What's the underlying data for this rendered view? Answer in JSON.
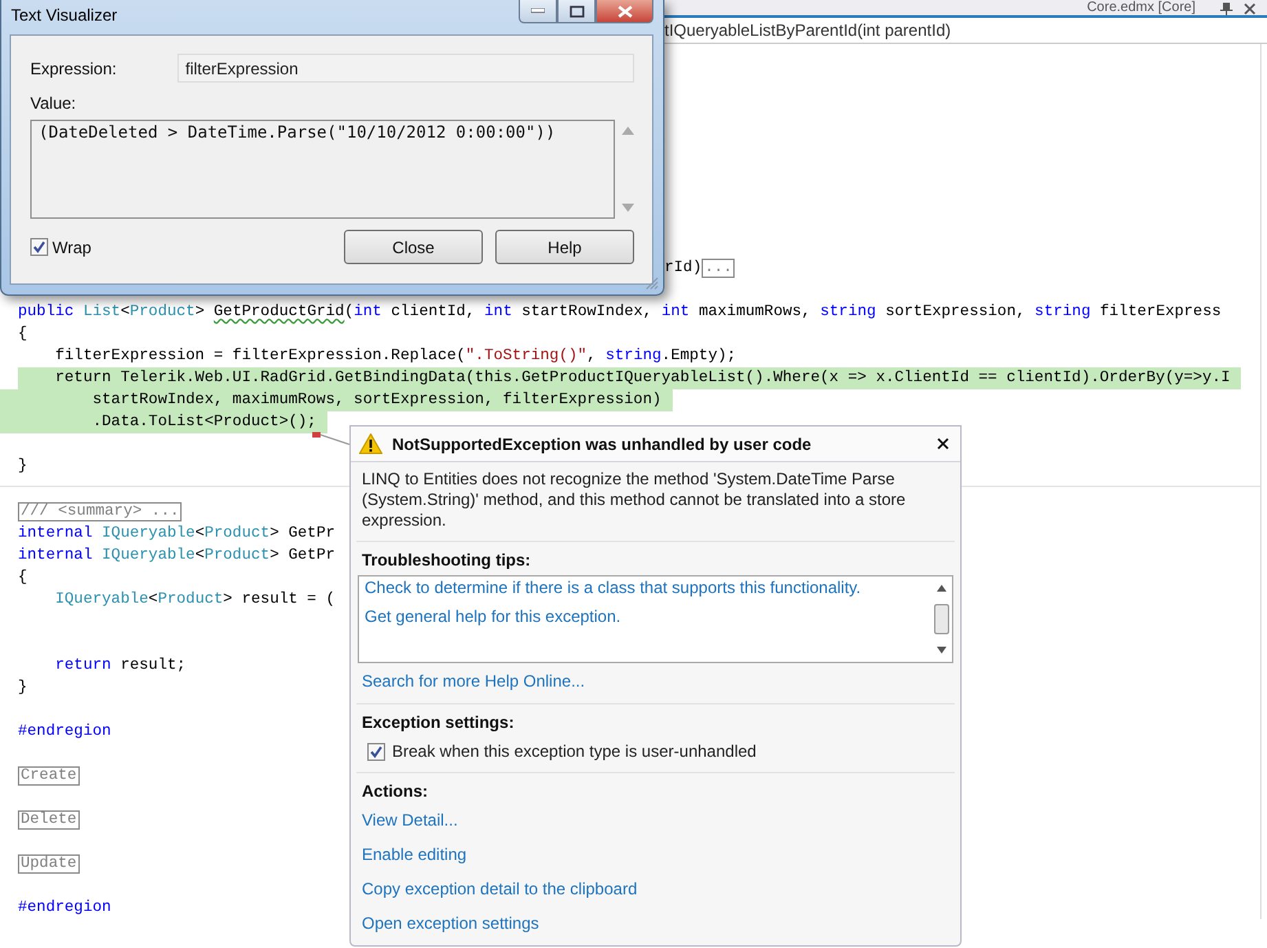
{
  "ide": {
    "document_tab": "Core.edmx [Core]",
    "member_dropdown": "tIQueryableListByParentId(int parentId)"
  },
  "code_lines": [
    {
      "kind": "tail",
      "highlighted": false,
      "tokens": [
        {
          "kind": "plain",
          "text": "rId)"
        },
        {
          "kind": "collapsed",
          "text": "..."
        }
      ]
    },
    {
      "kind": "blank"
    },
    {
      "kind": "code",
      "highlighted": false,
      "tokens": [
        {
          "kind": "kw",
          "text": "public "
        },
        {
          "kind": "type",
          "text": "List"
        },
        {
          "kind": "plain",
          "text": "<"
        },
        {
          "kind": "type",
          "text": "Product"
        },
        {
          "kind": "plain",
          "text": "> "
        },
        {
          "kind": "squiggled",
          "text": "GetProductGrid"
        },
        {
          "kind": "plain",
          "text": "("
        },
        {
          "kind": "kw",
          "text": "int"
        },
        {
          "kind": "plain",
          "text": " clientId, "
        },
        {
          "kind": "kw",
          "text": "int"
        },
        {
          "kind": "plain",
          "text": " startRowIndex, "
        },
        {
          "kind": "kw",
          "text": "int"
        },
        {
          "kind": "plain",
          "text": " maximumRows, "
        },
        {
          "kind": "kw",
          "text": "string"
        },
        {
          "kind": "plain",
          "text": " sortExpression, "
        },
        {
          "kind": "kw",
          "text": "string"
        },
        {
          "kind": "plain",
          "text": " filterExpress"
        }
      ]
    },
    {
      "kind": "code",
      "highlighted": false,
      "tokens": [
        {
          "kind": "plain",
          "text": "{"
        }
      ]
    },
    {
      "kind": "code",
      "highlighted": false,
      "tokens": [
        {
          "kind": "plain",
          "text": "    filterExpression = filterExpression.Replace("
        },
        {
          "kind": "string",
          "text": "\".ToString()\""
        },
        {
          "kind": "plain",
          "text": ", "
        },
        {
          "kind": "kw",
          "text": "string"
        },
        {
          "kind": "plain",
          "text": ".Empty);"
        }
      ]
    },
    {
      "kind": "code",
      "highlighted": true,
      "tokens": [
        {
          "kind": "plain",
          "text": "    return Telerik.Web.UI.RadGrid.GetBindingData(this.GetProductIQueryableList().Where(x => x.ClientId == clientId).OrderBy(y=>y.I"
        }
      ]
    },
    {
      "kind": "code",
      "highlighted": true,
      "tokens": [
        {
          "kind": "plain",
          "text": "        startRowIndex, maximumRows, sortExpression, filterExpression)"
        }
      ]
    },
    {
      "kind": "code",
      "highlighted": true,
      "tokens": [
        {
          "kind": "plain",
          "text": "        .Data.ToList<Product>();"
        }
      ]
    },
    {
      "kind": "blank"
    },
    {
      "kind": "code",
      "highlighted": false,
      "tokens": [
        {
          "kind": "plain",
          "text": "}"
        }
      ]
    },
    {
      "kind": "break"
    },
    {
      "kind": "code",
      "highlighted": false,
      "tokens": [
        {
          "kind": "collapsed",
          "text": "/// <summary> ..."
        }
      ]
    },
    {
      "kind": "code",
      "highlighted": false,
      "tokens": [
        {
          "kind": "kw",
          "text": "internal "
        },
        {
          "kind": "type",
          "text": "IQueryable"
        },
        {
          "kind": "plain",
          "text": "<"
        },
        {
          "kind": "type",
          "text": "Product"
        },
        {
          "kind": "plain",
          "text": "> GetPr"
        }
      ]
    },
    {
      "kind": "code",
      "highlighted": false,
      "tokens": [
        {
          "kind": "kw",
          "text": "internal "
        },
        {
          "kind": "type",
          "text": "IQueryable"
        },
        {
          "kind": "plain",
          "text": "<"
        },
        {
          "kind": "type",
          "text": "Product"
        },
        {
          "kind": "plain",
          "text": "> GetPr"
        }
      ]
    },
    {
      "kind": "code",
      "highlighted": false,
      "tokens": [
        {
          "kind": "plain",
          "text": "{"
        }
      ]
    },
    {
      "kind": "code",
      "highlighted": false,
      "tokens": [
        {
          "kind": "type",
          "text": "    IQueryable"
        },
        {
          "kind": "plain",
          "text": "<"
        },
        {
          "kind": "type",
          "text": "Product"
        },
        {
          "kind": "plain",
          "text": "> result = ("
        }
      ]
    },
    {
      "kind": "blank"
    },
    {
      "kind": "blank"
    },
    {
      "kind": "code",
      "highlighted": false,
      "tokens": [
        {
          "kind": "kw",
          "text": "    return"
        },
        {
          "kind": "plain",
          "text": " result;"
        }
      ]
    },
    {
      "kind": "code",
      "highlighted": false,
      "tokens": [
        {
          "kind": "plain",
          "text": "}"
        }
      ]
    },
    {
      "kind": "blank"
    },
    {
      "kind": "code",
      "highlighted": false,
      "tokens": [
        {
          "kind": "kw",
          "text": "#endregion"
        }
      ]
    },
    {
      "kind": "blank"
    },
    {
      "kind": "code",
      "highlighted": false,
      "tokens": [
        {
          "kind": "collapsed",
          "text": "Create"
        }
      ]
    },
    {
      "kind": "blank"
    },
    {
      "kind": "code",
      "highlighted": false,
      "tokens": [
        {
          "kind": "collapsed",
          "text": "Delete"
        }
      ]
    },
    {
      "kind": "blank"
    },
    {
      "kind": "code",
      "highlighted": false,
      "tokens": [
        {
          "kind": "collapsed",
          "text": "Update"
        }
      ]
    },
    {
      "kind": "blank"
    },
    {
      "kind": "code",
      "highlighted": false,
      "tokens": [
        {
          "kind": "kw",
          "text": "#endregion"
        }
      ]
    }
  ],
  "text_visualizer": {
    "title": "Text Visualizer",
    "expression_label": "Expression:",
    "expression": "filterExpression",
    "value_label": "Value:",
    "value": "(DateDeleted > DateTime.Parse(\"10/10/2012 0:00:00\"))",
    "wrap": {
      "label": "Wrap",
      "checked": true
    },
    "buttons": [
      "Close",
      "Help"
    ]
  },
  "exception_popup": {
    "title": "NotSupportedException was unhandled by user code",
    "message": "LINQ to Entities does not recognize the method 'System.DateTime Parse (System.String)' method, and this method cannot be translated into a store expression.",
    "troubleshooting": {
      "heading": "Troubleshooting tips:",
      "tips": [
        "Check to determine if there is a class that supports this functionality.",
        "Get general help for this exception."
      ]
    },
    "search_link": "Search for more Help Online...",
    "settings": {
      "heading": "Exception settings:",
      "break_option": {
        "label": "Break when this exception type is user-unhandled",
        "checked": true
      }
    },
    "actions": {
      "heading": "Actions:",
      "links": [
        "View Detail...",
        "Enable editing",
        "Copy exception detail to the clipboard",
        "Open exception settings"
      ]
    }
  }
}
